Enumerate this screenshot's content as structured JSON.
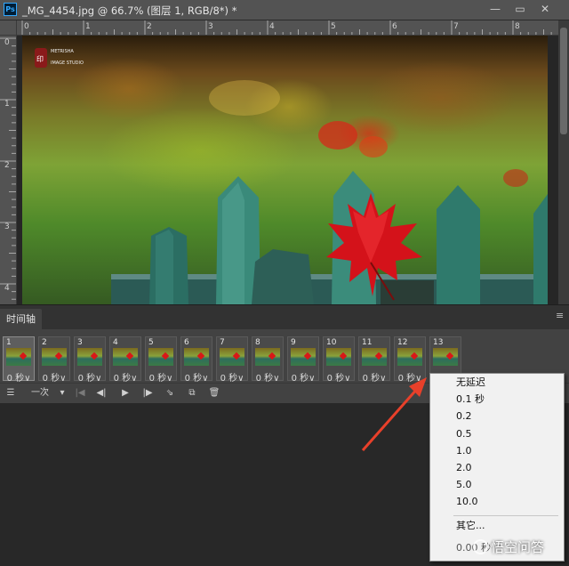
{
  "colors": {
    "panel_bg": "#424242",
    "canvas_bg": "#282828",
    "menu_bg": "#f1f1f1",
    "arrow": "#e8402a",
    "ps_blue": "#31a8ff"
  },
  "titlebar": {
    "app_icon": "Ps",
    "doc_title": "_MG_4454.jpg @ 66.7% (图层 1, RGB/8*) *",
    "minimize": "—",
    "maximize": "▭",
    "close": "✕"
  },
  "rulers": {
    "horizontal": [
      "0",
      "1",
      "2",
      "3",
      "4",
      "5",
      "6",
      "7",
      "8"
    ],
    "vertical": [
      "0",
      "1",
      "2",
      "3",
      "4"
    ]
  },
  "canvas": {
    "logo_line1": "METRISHA",
    "logo_line2": "IMAGE STUDIO"
  },
  "timeline": {
    "tab_label": "时间轴",
    "menu_icon": "≡",
    "frames": [
      {
        "num": "1",
        "delay": "0 秒"
      },
      {
        "num": "2",
        "delay": "0 秒"
      },
      {
        "num": "3",
        "delay": "0 秒"
      },
      {
        "num": "4",
        "delay": "0 秒"
      },
      {
        "num": "5",
        "delay": "0 秒"
      },
      {
        "num": "6",
        "delay": "0 秒"
      },
      {
        "num": "7",
        "delay": "0 秒"
      },
      {
        "num": "8",
        "delay": "0 秒"
      },
      {
        "num": "9",
        "delay": "0 秒"
      },
      {
        "num": "10",
        "delay": "0 秒"
      },
      {
        "num": "11",
        "delay": "0 秒"
      },
      {
        "num": "12",
        "delay": "0 秒"
      },
      {
        "num": "13",
        "delay": "0 秒"
      }
    ],
    "delay_chevron": "∨",
    "selected_frame": "1",
    "toolbar": {
      "convert_icon": "☰",
      "loop_value": "一次",
      "loop_dropdown": "▾",
      "first_frame": "|◀",
      "prev_frame": "◀|",
      "play": "▶",
      "next_frame": "|▶",
      "tween": "⇘",
      "duplicate": "⧉",
      "delete": "🗑"
    }
  },
  "delay_menu": {
    "items": [
      "无延迟",
      "0.1 秒",
      "0.2",
      "0.5",
      "1.0",
      "2.0",
      "5.0",
      "10.0"
    ],
    "other": "其它...",
    "current": "0.00 秒"
  },
  "watermark": "悟空问答"
}
